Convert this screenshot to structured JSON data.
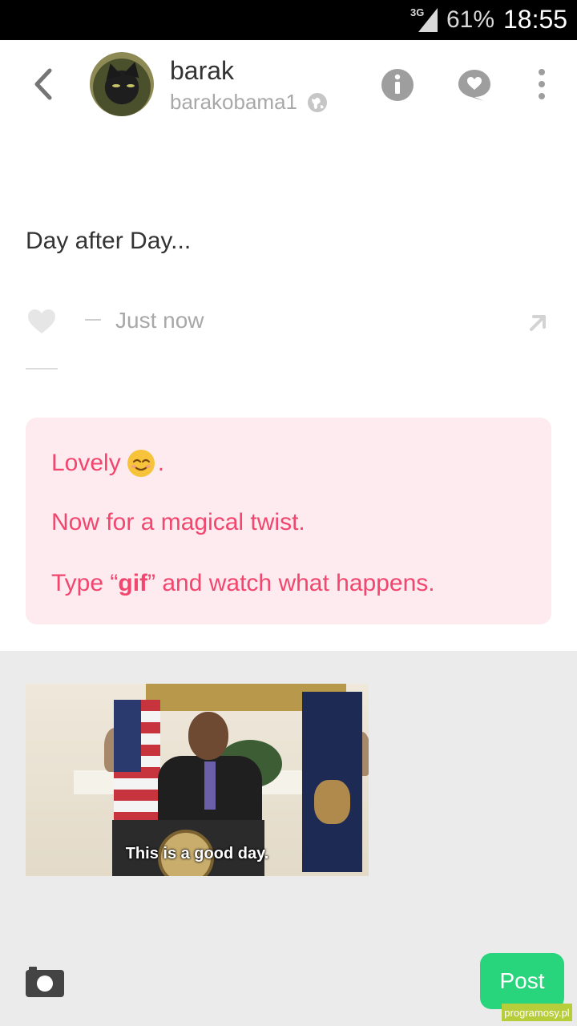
{
  "status_bar": {
    "network": "3G",
    "battery": "61%",
    "time": "18:55"
  },
  "header": {
    "name": "barak",
    "handle": "barakobama1",
    "icons": [
      "back-icon",
      "info-icon",
      "chat-icon",
      "more-icon",
      "globe-icon"
    ]
  },
  "post": {
    "text": "Day after Day...",
    "timestamp": "Just now"
  },
  "tip_card": {
    "line1_text": "Lovely",
    "line1_suffix": ".",
    "line2": "Now for a magical twist.",
    "line3_prefix": "Type “",
    "line3_keyword": "gif",
    "line3_suffix": "” and watch what happens."
  },
  "composer": {
    "gif_caption": "This is a good day.",
    "post_button": "Post"
  },
  "watermark": "programosy.pl",
  "colors": {
    "accent_pink": "#f2466e",
    "card_bg": "#fdebef",
    "post_button": "#29d57c",
    "composer_bg": "#ebebeb"
  }
}
